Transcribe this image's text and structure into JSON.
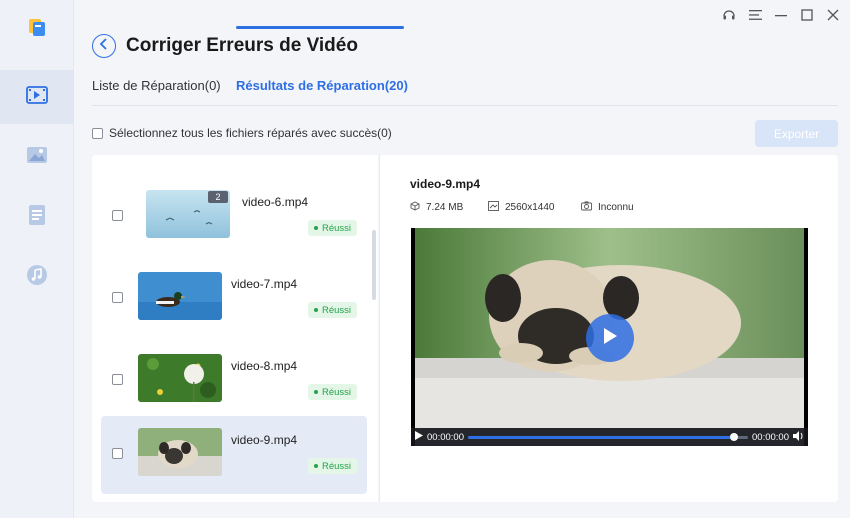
{
  "header": {
    "title": "Corriger Erreurs de Vidéo"
  },
  "tabs": [
    {
      "label": "Liste de Réparation(0)",
      "active": false
    },
    {
      "label": "Résultats de Réparation(20)",
      "active": true
    }
  ],
  "select_all_label": "Sélectionnez tous les fichiers réparés avec succès(0)",
  "export_label": "Exporter",
  "sidebar": {
    "items": [
      {
        "icon": "app-logo-icon"
      },
      {
        "icon": "video-icon",
        "active": true
      },
      {
        "icon": "image-icon"
      },
      {
        "icon": "document-icon"
      },
      {
        "icon": "music-icon"
      }
    ]
  },
  "files": [
    {
      "name": "video-6.mp4",
      "status": "Réussi",
      "count": "2",
      "thumb_color": "#a9d3e6"
    },
    {
      "name": "video-7.mp4",
      "status": "Réussi",
      "thumb_color": "#3f8fd0"
    },
    {
      "name": "video-8.mp4",
      "status": "Réussi",
      "thumb_color": "#3d7a2a"
    },
    {
      "name": "video-9.mp4",
      "status": "Réussi",
      "thumb_color": "#cfc8bd",
      "selected": true
    }
  ],
  "preview": {
    "title": "video-9.mp4",
    "size": "7.24 MB",
    "resolution": "2560x1440",
    "duration": "Inconnu",
    "time_current": "00:00:00",
    "time_total": "00:00:00",
    "progress": 0.95
  },
  "colors": {
    "accent": "#2f6fe4",
    "success": "#27a34a",
    "export_disabled": "#d8e4f7"
  }
}
